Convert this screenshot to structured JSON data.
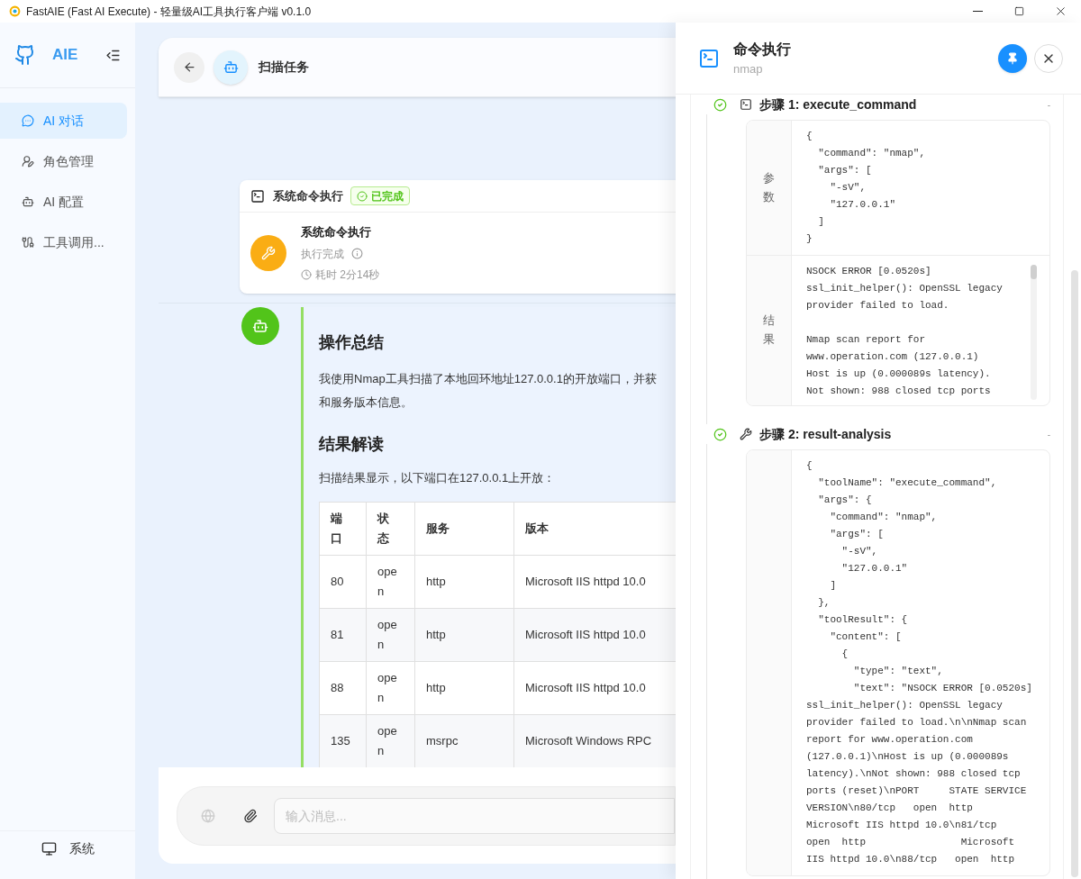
{
  "window": {
    "title": "FastAIE (Fast AI Execute) - 轻量级AI工具执行客户端 v0.1.0"
  },
  "sidebar": {
    "logo": "AIE",
    "items": [
      {
        "label": "AI 对话",
        "selected": true
      },
      {
        "label": "角色管理",
        "selected": false
      },
      {
        "label": "AI 配置",
        "selected": false
      },
      {
        "label": "工具调用...",
        "selected": false
      }
    ],
    "footer": "系统"
  },
  "chat": {
    "title": "扫描任务",
    "tool_card": {
      "header": "系统命令执行",
      "status": "已完成",
      "name": "系统命令执行",
      "state": "执行完成",
      "duration": "耗时 2分14秒"
    },
    "message": {
      "heading1": "操作总结",
      "paragraph_lines": [
        "我使用Nmap工具扫描了本地回环地址127.0.0.1的开放端口，并获",
        "和服务版本信息。"
      ],
      "heading2": "结果解读",
      "intro": "扫描结果显示，以下端口在127.0.0.1上开放：",
      "table": {
        "columns": [
          "端口",
          "状态",
          "服务",
          "版本"
        ],
        "rows": [
          [
            "80",
            "open",
            "http",
            "Microsoft IIS httpd 10.0"
          ],
          [
            "81",
            "open",
            "http",
            "Microsoft IIS httpd 10.0"
          ],
          [
            "88",
            "open",
            "http",
            "Microsoft IIS httpd 10.0"
          ],
          [
            "135",
            "open",
            "msrpc",
            "Microsoft Windows RPC"
          ]
        ]
      }
    },
    "input": {
      "placeholder": "输入消息..."
    }
  },
  "drawer": {
    "title": "命令执行",
    "subtitle": "nmap",
    "steps": [
      {
        "kind": "command",
        "title": "步骤 1: execute_command",
        "collapse": "-",
        "params_label": "参数",
        "params": "{\n  \"command\": \"nmap\",\n  \"args\": [\n    \"-sV\",\n    \"127.0.0.1\"\n  ]\n}",
        "result_label": "结果",
        "result": "NSOCK ERROR [0.0520s]\nssl_init_helper(): OpenSSL legacy\nprovider failed to load.\n\nNmap scan report for\nwww.operation.com (127.0.0.1)\nHost is up (0.000089s latency).\nNot shown: 988 closed tcp ports"
      },
      {
        "kind": "analysis",
        "title": "步骤 2: result-analysis",
        "collapse": "-",
        "params": "{\n  \"toolName\": \"execute_command\",\n  \"args\": {\n    \"command\": \"nmap\",\n    \"args\": [\n      \"-sV\",\n      \"127.0.0.1\"\n    ]\n  },\n  \"toolResult\": {\n    \"content\": [\n      {\n        \"type\": \"text\",\n        \"text\": \"NSOCK ERROR [0.0520s]\nssl_init_helper(): OpenSSL legacy\nprovider failed to load.\\n\\nNmap scan\nreport for www.operation.com\n(127.0.0.1)\\nHost is up (0.000089s\nlatency).\\nNot shown: 988 closed tcp\nports (reset)\\nPORT     STATE SERVICE\nVERSION\\n80/tcp   open  http\nMicrosoft IIS httpd 10.0\\n81/tcp\nopen  http                Microsoft\nIIS httpd 10.0\\n88/tcp   open  http"
      }
    ]
  }
}
